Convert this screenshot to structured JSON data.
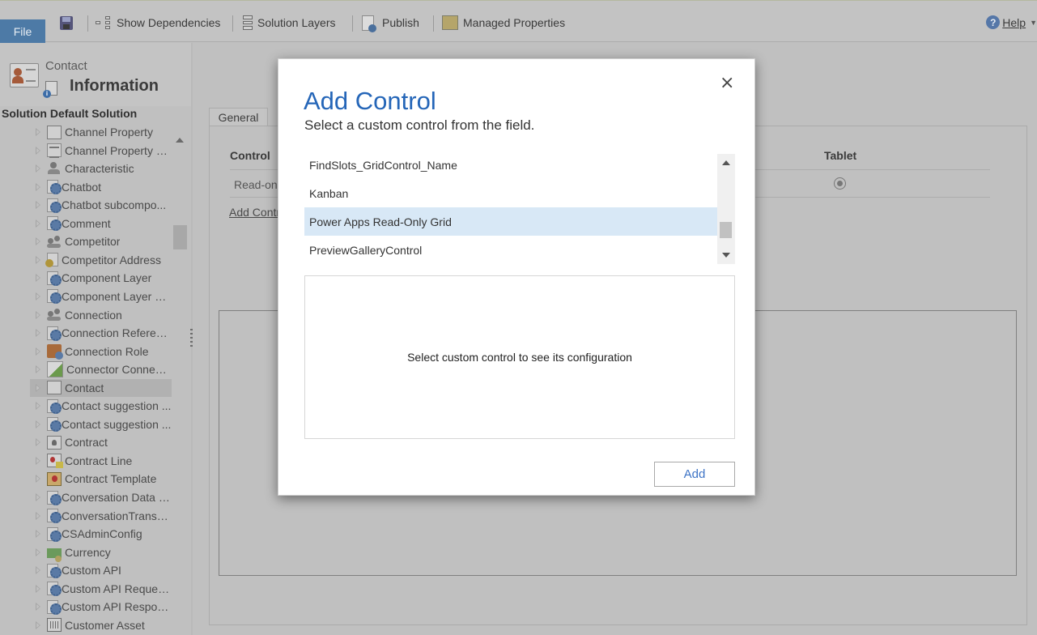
{
  "ribbon": {
    "file_label": "File",
    "save_icon": "save-icon",
    "items": [
      {
        "label": "Show Dependencies",
        "icon": "dependencies-icon"
      },
      {
        "label": "Solution Layers",
        "icon": "layers-icon"
      },
      {
        "label": "Publish",
        "icon": "publish-icon"
      },
      {
        "label": "Managed Properties",
        "icon": "managed-properties-icon"
      }
    ],
    "help_label": "Help",
    "help_icon_glyph": "?"
  },
  "header": {
    "entity_name": "Contact",
    "form_title": "Information",
    "solution_label": "Solution Default Solution"
  },
  "tree": {
    "items": [
      {
        "label": "Channel Property",
        "icon": "card"
      },
      {
        "label": "Channel Property G...",
        "icon": "grid"
      },
      {
        "label": "Characteristic",
        "icon": "person"
      },
      {
        "label": "Chatbot",
        "icon": "gear"
      },
      {
        "label": "Chatbot subcompo...",
        "icon": "gear"
      },
      {
        "label": "Comment",
        "icon": "gear"
      },
      {
        "label": "Competitor",
        "icon": "people"
      },
      {
        "label": "Competitor Address",
        "icon": "gold"
      },
      {
        "label": "Component Layer",
        "icon": "gear"
      },
      {
        "label": "Component Layer D...",
        "icon": "gear"
      },
      {
        "label": "Connection",
        "icon": "people"
      },
      {
        "label": "Connection Referen...",
        "icon": "gear"
      },
      {
        "label": "Connection Role",
        "icon": "role"
      },
      {
        "label": "Connector Connector",
        "icon": "img"
      },
      {
        "label": "Contact",
        "icon": "card",
        "selected": true
      },
      {
        "label": "Contact suggestion ...",
        "icon": "gear"
      },
      {
        "label": "Contact suggestion ...",
        "icon": "gear"
      },
      {
        "label": "Contract",
        "icon": "contract"
      },
      {
        "label": "Contract Line",
        "icon": "cline"
      },
      {
        "label": "Contract Template",
        "icon": "ctemplate"
      },
      {
        "label": "Conversation Data (...",
        "icon": "gear"
      },
      {
        "label": "ConversationTransc...",
        "icon": "gear"
      },
      {
        "label": "CSAdminConfig",
        "icon": "gear"
      },
      {
        "label": "Currency",
        "icon": "currency"
      },
      {
        "label": "Custom API",
        "icon": "gear"
      },
      {
        "label": "Custom API Reques...",
        "icon": "gear"
      },
      {
        "label": "Custom API Respon...",
        "icon": "gear"
      },
      {
        "label": "Customer Asset",
        "icon": "asset"
      }
    ]
  },
  "form": {
    "tab_label": "General",
    "col_control": "Control",
    "col_tablet": "Tablet",
    "row_control_value": "Read-onl",
    "add_control_link": "Add Contr",
    "tablet_selected": true
  },
  "modal": {
    "title": "Add Control",
    "subtitle": "Select a custom control from the field.",
    "close_glyph": "×",
    "controls": [
      {
        "label": "FindSlots_GridControl_Name",
        "selected": false
      },
      {
        "label": "Kanban",
        "selected": false
      },
      {
        "label": "Power Apps Read-Only Grid",
        "selected": true
      },
      {
        "label": "PreviewGalleryControl",
        "selected": false
      }
    ],
    "config_placeholder": "Select custom control to see its configuration",
    "add_label": "Add"
  },
  "colors": {
    "accent_blue": "#2566b8",
    "file_button": "#4d7aa6",
    "selected_row": "#d8e8f6",
    "overlay_gray": "#c0c0c0"
  }
}
